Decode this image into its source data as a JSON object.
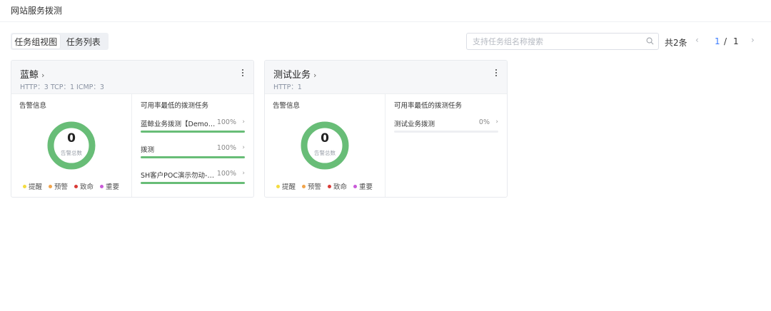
{
  "page": {
    "title": "网站服务拨测"
  },
  "view_switch": {
    "tabs": [
      {
        "label": "任务组视图",
        "active": true
      },
      {
        "label": "任务列表",
        "active": false
      }
    ]
  },
  "search": {
    "placeholder": "支持任务组名称搜索"
  },
  "pagination": {
    "total": "共2条",
    "current": "1",
    "separator": "/",
    "total_pages": "1"
  },
  "colors": {
    "accent": "#3b7cff",
    "success": "#68bd77",
    "remind": "#f4dc40",
    "warning": "#f1a44a",
    "fatal": "#d93a36",
    "important": "#c95ad8"
  },
  "cards": [
    {
      "name": "蓝鲸",
      "protocols": "HTTP：3   TCP：1   ICMP：3",
      "alarm": {
        "title": "告警信息",
        "count": "0",
        "count_label": "告警总数"
      },
      "legend": [
        "提醒",
        "预警",
        "致命",
        "重要"
      ],
      "tasks_title": "可用率最低的拨测任务",
      "tasks": [
        {
          "name": "蓝鲸业务拨测【Demo演示】",
          "percent_label": "100%",
          "availability": 100
        },
        {
          "name": "拨测",
          "percent_label": "100%",
          "availability": 100
        },
        {
          "name": "SH客户POC演示勿动-百度",
          "percent_label": "100%",
          "availability": 100
        }
      ]
    },
    {
      "name": "测试业务",
      "protocols": "HTTP：1",
      "alarm": {
        "title": "告警信息",
        "count": "0",
        "count_label": "告警总数"
      },
      "legend": [
        "提醒",
        "预警",
        "致命",
        "重要"
      ],
      "tasks_title": "可用率最低的拨测任务",
      "tasks": [
        {
          "name": "测试业务拨测",
          "percent_label": "0%",
          "availability": 0
        }
      ]
    }
  ]
}
